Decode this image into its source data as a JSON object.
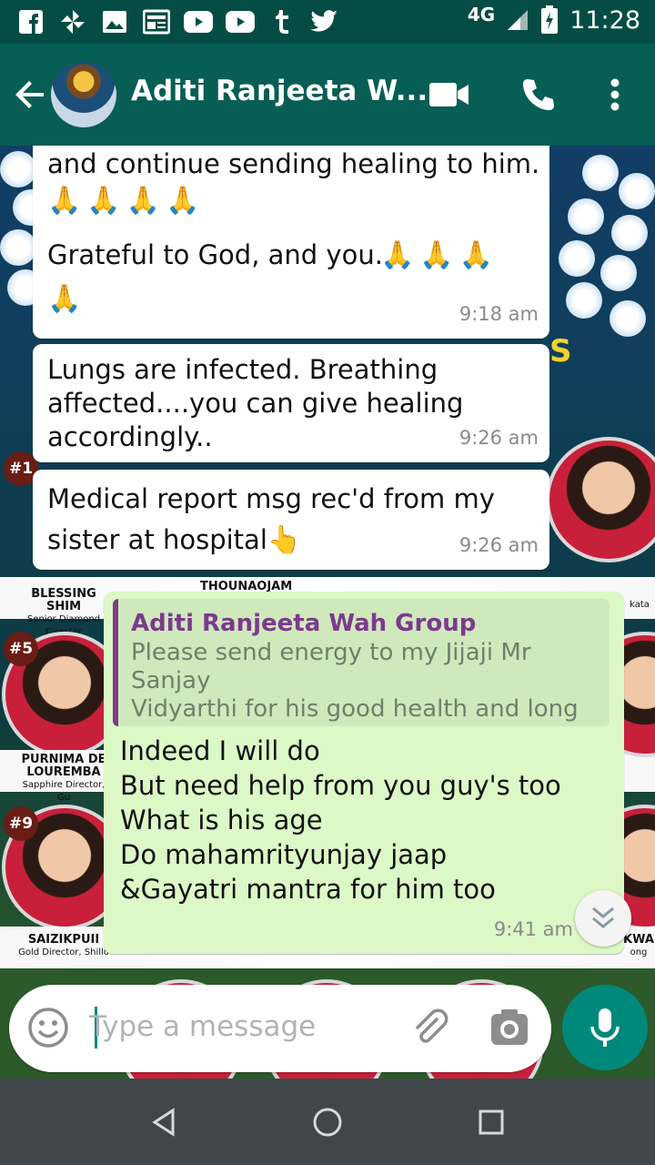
{
  "status_bar": {
    "network": "4G",
    "time": "11:28",
    "notification_icons": [
      "facebook-icon",
      "pinwheel-icon",
      "gallery-icon",
      "newspaper-icon",
      "youtube-icon",
      "youtube-icon",
      "tumblr-icon",
      "twitter-icon"
    ]
  },
  "header": {
    "title": "Aditi Ranjeeta W...",
    "avatar": "group-avatar",
    "actions": [
      "video-call-icon",
      "phone-icon",
      "more-vert-icon"
    ]
  },
  "messages": [
    {
      "direction": "incoming",
      "text": "and continue sending healing to him.",
      "emoji_line_1": "🙏🙏🙏🙏",
      "text_2": "Grateful to God, and you.",
      "emoji_line_2": "🙏🙏🙏",
      "emoji_line_3": "🙏",
      "time": "9:18 am"
    },
    {
      "direction": "incoming",
      "text": "Lungs are infected. Breathing\naffected....you can give healing\naccordingly..",
      "time": "9:26 am"
    },
    {
      "direction": "incoming",
      "text": "Medical report msg rec'd from my\nsister at hospital",
      "emoji": "👆",
      "time": "9:26 am"
    },
    {
      "direction": "outgoing",
      "quote": {
        "author": "Aditi Ranjeeta Wah Group",
        "text": "Please send energy to my Jijaji Mr Sanjay\nVidyarthi for his good health and long life.\nHe is admitted in ICU following a wheezi..."
      },
      "text": "Indeed I will do\nBut need help from you guy's too\nWhat is his age\nDo mahamrityunjay jaap\n&Gayatri mantra for him too",
      "time": "9:41 am"
    }
  ],
  "wallpaper": {
    "banner": "S",
    "ranks": [
      "#1",
      "#5",
      "#9"
    ],
    "labels": [
      {
        "name": "BLESSING SHIM",
        "sub": "Senior Diamond Director"
      },
      {
        "name": "THOUNAOJAM",
        "sub": ""
      },
      {
        "name": "PURNIMA DE\nLOUREMBA",
        "sub": "Sapphire Director, Gu"
      },
      {
        "name": "SAIZIKPUII",
        "sub": "Gold Director, Shillo"
      },
      {
        "name": "KWA",
        "sub": "ong"
      },
      {
        "name": "kata",
        "sub": ""
      }
    ]
  },
  "composer": {
    "placeholder": "Type a message",
    "icons": [
      "emoji-icon",
      "attach-icon",
      "camera-icon",
      "mic-icon"
    ]
  },
  "navigation": [
    "back-nav-icon",
    "home-nav-icon",
    "recents-nav-icon"
  ],
  "colors": {
    "header": "#075e54",
    "status_bar": "#054d44",
    "outgoing_bubble": "#dcf8c6",
    "incoming_bubble": "#ffffff",
    "accent": "#00897b",
    "quote_author": "#7c3a8c"
  }
}
